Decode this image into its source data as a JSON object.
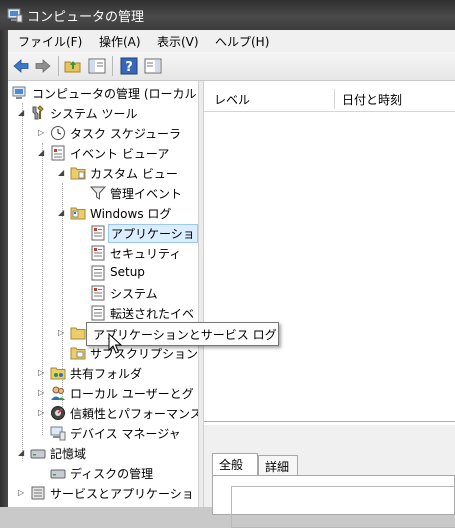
{
  "window": {
    "title": "コンピュータの管理"
  },
  "menu": [
    {
      "label": "ファイル(F)"
    },
    {
      "label": "操作(A)"
    },
    {
      "label": "表示(V)"
    },
    {
      "label": "ヘルプ(H)"
    }
  ],
  "tree": {
    "items": [
      {
        "label": "コンピュータの管理 (ローカル",
        "icon": "computer-management-icon",
        "expander": "none"
      },
      {
        "label": "システム ツール",
        "icon": "system-tools-icon",
        "expander": "expanded"
      },
      {
        "label": "タスク スケジューラ",
        "icon": "clock-icon",
        "expander": "collapsed"
      },
      {
        "label": "イベント ビューア",
        "icon": "event-viewer-icon",
        "expander": "expanded"
      },
      {
        "label": "カスタム ビュー",
        "icon": "folder-icon",
        "expander": "expanded"
      },
      {
        "label": "管理イベント",
        "icon": "filter-icon",
        "expander": "none"
      },
      {
        "label": "Windows ログ",
        "icon": "folder-icon",
        "expander": "expanded"
      },
      {
        "label": "アプリケーショ",
        "icon": "log-icon",
        "expander": "none",
        "selected": true
      },
      {
        "label": "セキュリティ",
        "icon": "log-icon",
        "expander": "none"
      },
      {
        "label": "Setup",
        "icon": "log-icon",
        "expander": "none"
      },
      {
        "label": "システム",
        "icon": "log-icon",
        "expander": "none"
      },
      {
        "label": "転送されたイベ",
        "icon": "log-icon",
        "expander": "none"
      },
      {
        "label": "",
        "icon": "folder-icon",
        "expander": "collapsed"
      },
      {
        "label": "サブスクリプション",
        "icon": "subscription-icon",
        "expander": "none"
      },
      {
        "label": "共有フォルダ",
        "icon": "shared-folder-icon",
        "expander": "collapsed"
      },
      {
        "label": "ローカル ユーザーとグ",
        "icon": "users-icon",
        "expander": "collapsed"
      },
      {
        "label": "信頼性とパフォーマンス",
        "icon": "performance-icon",
        "expander": "collapsed"
      },
      {
        "label": "デバイス マネージャ",
        "icon": "device-manager-icon",
        "expander": "none"
      },
      {
        "label": "記憶域",
        "icon": "storage-icon",
        "expander": "expanded"
      },
      {
        "label": "ディスクの管理",
        "icon": "disk-icon",
        "expander": "none"
      },
      {
        "label": "サービスとアプリケーショ",
        "icon": "services-icon",
        "expander": "collapsed"
      }
    ]
  },
  "list": {
    "columns": [
      {
        "label": "レベル"
      },
      {
        "label": "日付と時刻"
      }
    ]
  },
  "details": {
    "tabs": [
      {
        "label": "全般"
      },
      {
        "label": "詳細"
      }
    ]
  },
  "tooltip": {
    "text": "アプリケーションとサービス ログ"
  }
}
